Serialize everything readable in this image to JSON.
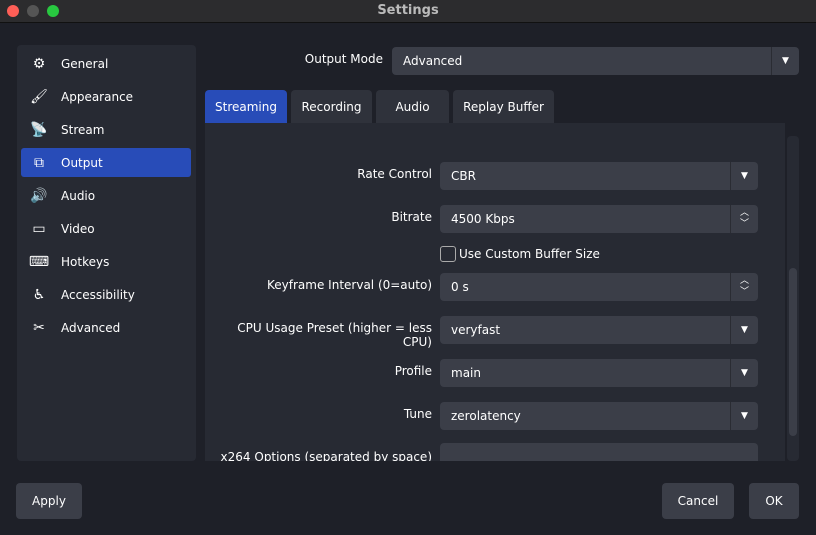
{
  "window": {
    "title": "Settings"
  },
  "sidebar": {
    "items": [
      {
        "label": "General",
        "icon": "gear-icon",
        "glyph": "⚙"
      },
      {
        "label": "Appearance",
        "icon": "appearance-icon",
        "glyph": "🖌"
      },
      {
        "label": "Stream",
        "icon": "antenna-icon",
        "glyph": "📡"
      },
      {
        "label": "Output",
        "icon": "output-icon",
        "glyph": "⧉",
        "selected": true
      },
      {
        "label": "Audio",
        "icon": "speaker-icon",
        "glyph": "🔊"
      },
      {
        "label": "Video",
        "icon": "monitor-icon",
        "glyph": "▭"
      },
      {
        "label": "Hotkeys",
        "icon": "keyboard-icon",
        "glyph": "⌨"
      },
      {
        "label": "Accessibility",
        "icon": "accessibility-icon",
        "glyph": "♿"
      },
      {
        "label": "Advanced",
        "icon": "tools-icon",
        "glyph": "✂"
      }
    ]
  },
  "output_mode": {
    "label": "Output Mode",
    "value": "Advanced"
  },
  "tabs": [
    {
      "label": "Streaming",
      "selected": true
    },
    {
      "label": "Recording"
    },
    {
      "label": "Audio"
    },
    {
      "label": "Replay Buffer"
    }
  ],
  "fields": {
    "rate_control": {
      "label": "Rate Control",
      "value": "CBR"
    },
    "bitrate": {
      "label": "Bitrate",
      "value": "4500 Kbps"
    },
    "custom_buffer": {
      "label": "Use Custom Buffer Size",
      "checked": false
    },
    "keyframe": {
      "label": "Keyframe Interval (0=auto)",
      "value": "0 s"
    },
    "cpu_preset": {
      "label": "CPU Usage Preset (higher = less CPU)",
      "value": "veryfast"
    },
    "profile": {
      "label": "Profile",
      "value": "main"
    },
    "tune": {
      "label": "Tune",
      "value": "zerolatency"
    },
    "x264_options": {
      "label": "x264 Options (separated by space)",
      "value": ""
    }
  },
  "buttons": {
    "apply": "Apply",
    "cancel": "Cancel",
    "ok": "OK"
  },
  "colors": {
    "accent": "#284cb8",
    "background": "#1e2028",
    "panel": "#272a33",
    "input": "#3b3e48"
  }
}
